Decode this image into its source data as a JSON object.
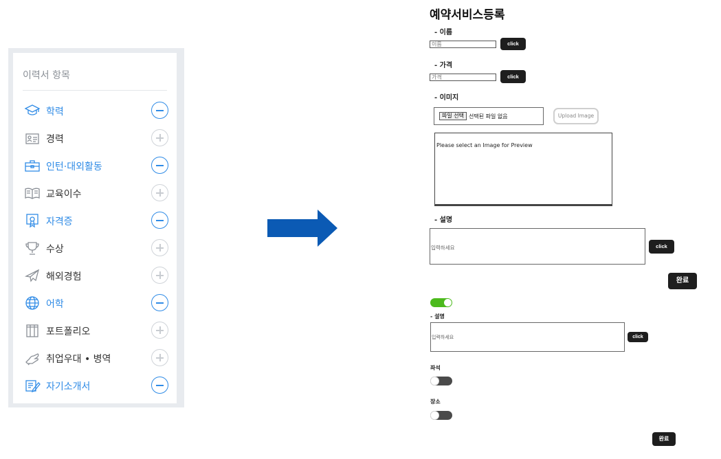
{
  "resume_panel": {
    "title": "이력서 항목",
    "items": [
      {
        "label": "학력",
        "icon": "graduation-cap-icon",
        "active": true
      },
      {
        "label": "경력",
        "icon": "id-card-icon",
        "active": false
      },
      {
        "label": "인턴·대외활동",
        "icon": "briefcase-icon",
        "active": true
      },
      {
        "label": "교육이수",
        "icon": "book-icon",
        "active": false
      },
      {
        "label": "자격증",
        "icon": "certificate-icon",
        "active": true
      },
      {
        "label": "수상",
        "icon": "trophy-icon",
        "active": false
      },
      {
        "label": "해외경험",
        "icon": "airplane-icon",
        "active": false
      },
      {
        "label": "어학",
        "icon": "globe-icon",
        "active": true
      },
      {
        "label": "포트폴리오",
        "icon": "portfolio-icon",
        "active": false
      },
      {
        "label": "취업우대 • 병역",
        "icon": "hand-icon",
        "active": false
      },
      {
        "label": "자기소개서",
        "icon": "pencil-doc-icon",
        "active": true
      }
    ],
    "accent_color": "#2f8be6"
  },
  "arrow": {
    "color": "#0b5ab4"
  },
  "form": {
    "title": "예약서비스등록",
    "name_section": {
      "label": "- 이름",
      "placeholder": "이름",
      "button": "click"
    },
    "price_section": {
      "label": "- 가격",
      "placeholder": "가격",
      "button": "click"
    },
    "image_section": {
      "label": "- 이미지",
      "file_button": "파일 선택",
      "file_status": "선택된 파일 없음",
      "upload_button": "Upload Image",
      "preview_text": "Please select an Image for Preview"
    },
    "desc_section": {
      "label": "- 설명",
      "placeholder": "입력하세요",
      "button": "click"
    },
    "done_button": "완료",
    "toggle1": {
      "state": "on"
    },
    "desc2_section": {
      "label": "- 설명",
      "placeholder": "입력하세요",
      "button": "click"
    },
    "seat_label": "좌석",
    "toggle2": {
      "state": "off"
    },
    "place_label": "장소",
    "toggle3": {
      "state": "off"
    },
    "done_button2": "완료"
  }
}
